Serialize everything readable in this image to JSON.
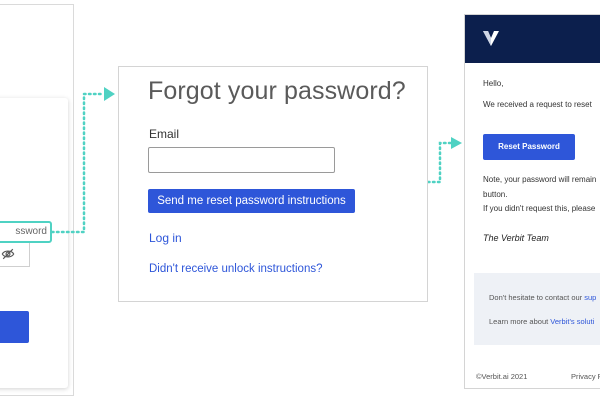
{
  "login_panel": {
    "password_placeholder_visible": "ssword",
    "eye_icon": "eye-slash-icon"
  },
  "forgot_card": {
    "title": "Forgot your password?",
    "email_label": "Email",
    "email_value": "",
    "submit_label": "Send me reset password instructions",
    "login_link": "Log in",
    "unlock_link": "Didn't receive unlock instructions?"
  },
  "reset_email": {
    "greeting": "Hello,",
    "request_line": "We received a request to reset",
    "button_label": "Reset Password",
    "note_line1": "Note, your password will remain",
    "note_line2": "button.",
    "note_line3": "If you didn't request this, please",
    "signature": "The Verbit Team",
    "footer_contact_prefix": "Don't hesitate to contact our ",
    "footer_contact_link": "sup",
    "footer_learn_prefix": "Learn more about ",
    "footer_learn_link": "Verbit's soluti",
    "copyright": "©Verbit.ai 2021",
    "privacy": "Privacy P"
  },
  "colors": {
    "accent_blue": "#2e56d9",
    "connector_teal": "#4fd2c3",
    "email_header_navy": "#0c1f4d"
  }
}
